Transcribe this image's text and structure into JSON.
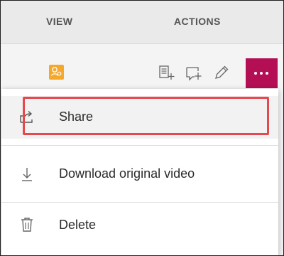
{
  "header": {
    "columns": [
      "VIEW",
      "ACTIONS"
    ]
  },
  "toolbar": {
    "view_icon": "user-group-icon",
    "action_icons": [
      "add-to-list-icon",
      "add-comment-icon",
      "edit-pencil-icon",
      "more-options-icon"
    ],
    "more_button_color": "#b40e55",
    "badge_color": "#f6a82c"
  },
  "menu": {
    "items": [
      {
        "label": "Share",
        "icon": "share-icon"
      },
      {
        "label": "Download original video",
        "icon": "download-icon"
      },
      {
        "label": "Delete",
        "icon": "trash-icon"
      }
    ],
    "focus_outline_color": "#e5484d"
  }
}
